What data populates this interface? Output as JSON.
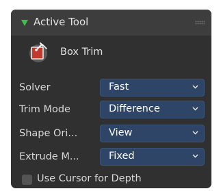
{
  "panel": {
    "title": "Active Tool"
  },
  "tool": {
    "name": "Box Trim",
    "icon": "box-trim-icon"
  },
  "properties": [
    {
      "label": "Solver",
      "value": "Fast"
    },
    {
      "label": "Trim Mode",
      "value": "Difference"
    },
    {
      "label": "Shape Ori...",
      "value": "View"
    },
    {
      "label": "Extrude M...",
      "value": "Fixed"
    }
  ],
  "checkbox": {
    "label": "Use Cursor for Depth",
    "checked": false
  },
  "colors": {
    "panel_bg": "#303030",
    "header_bg": "#3d3d3d",
    "dropdown_bg": "#2e4568",
    "accent_green": "#3fbe4c"
  }
}
